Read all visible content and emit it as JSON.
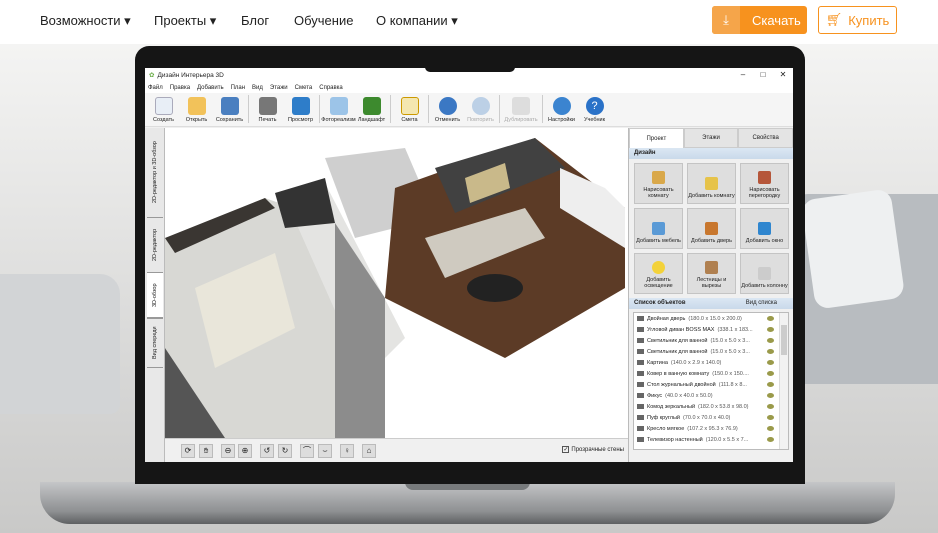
{
  "nav": {
    "items": [
      "Возможности ▾",
      "Проекты ▾",
      "Блог",
      "Обучение",
      "О компании ▾"
    ],
    "download": "Скачать",
    "buy": "Купить"
  },
  "app": {
    "title": "Дизайн Интерьера 3D",
    "menu": [
      "Файл",
      "Правка",
      "Добавить",
      "План",
      "Вид",
      "Этажи",
      "Смета",
      "Справка"
    ],
    "toolbar": [
      "Создать",
      "Открыть",
      "Сохранить",
      "Печать",
      "Просмотр",
      "Фотореализм",
      "Ландшафт",
      "Смета",
      "Отменить",
      "Повторить",
      "Дублировать",
      "Настройки",
      "Учебник"
    ],
    "side_tabs": [
      "2D-редактор и 3D-обзор",
      "2D-редактор",
      "3D-обзор",
      "Вид спереди"
    ],
    "view_bar": {
      "transparent_walls": "Прозрачные стены"
    },
    "panel": {
      "tabs": [
        "Проект",
        "Этажи",
        "Свойства"
      ],
      "design_header": "Дизайн",
      "buttons": [
        "Нарисовать комнату",
        "Добавить комнату",
        "Нарисовать перегородку",
        "Добавить мебель",
        "Добавить дверь",
        "Добавить окно",
        "Добавить освещение",
        "Лестницы и вырезы",
        "Добавить колонну"
      ],
      "objects_header": "Список объектов",
      "list_view": "Вид списка",
      "objects": [
        {
          "name": "Двойная дверь",
          "size": "(180.0 x 15.0 x 200.0)"
        },
        {
          "name": "Угловой диван BOSS MAX",
          "size": "(338.1 x 183..."
        },
        {
          "name": "Светильник для ванной",
          "size": "(15.0 x 5.0 x 3..."
        },
        {
          "name": "Светильник для ванной",
          "size": "(15.0 x 5.0 x 3..."
        },
        {
          "name": "Картина",
          "size": "(140.0 x 2.9 x 140.0)"
        },
        {
          "name": "Ковер в ванную комнату",
          "size": "(150.0 x 150...."
        },
        {
          "name": "Стол журнальный двойной",
          "size": "(111.8 x 8..."
        },
        {
          "name": "Фикус",
          "size": "(40.0 x 40.0 x 50.0)"
        },
        {
          "name": "Комод зеркальный",
          "size": "(182.0 x 53.8 x 98.0)"
        },
        {
          "name": "Пуф круглый",
          "size": "(70.0 x 70.0 x 40.0)"
        },
        {
          "name": "Кресло мягкое",
          "size": "(107.2 x 95.3 x 76.9)"
        },
        {
          "name": "Телевизор настенный",
          "size": "(120.0 x 5.5 x 7..."
        }
      ]
    }
  },
  "colors": {
    "accent": "#f7921e"
  }
}
